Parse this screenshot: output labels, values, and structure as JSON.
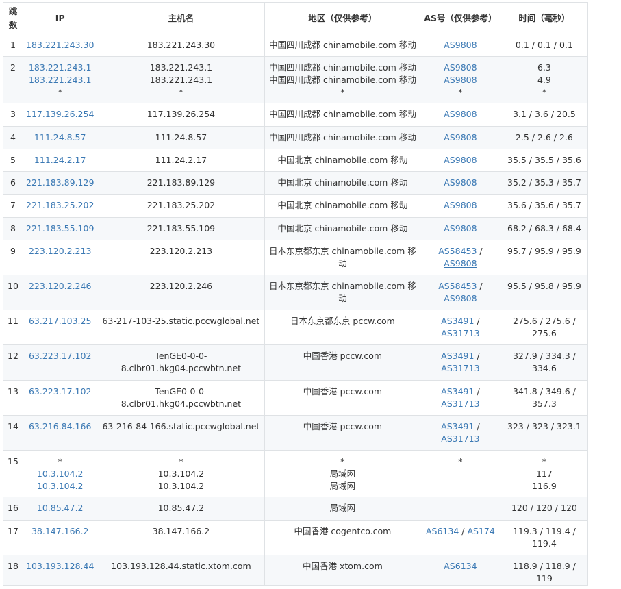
{
  "headers": [
    "跳数",
    "IP",
    "主机名",
    "地区（仅供参考）",
    "AS号（仅供参考）",
    "时间（毫秒）"
  ],
  "rows": [
    {
      "hop": "1",
      "ip": [
        "183.221.243.30"
      ],
      "host": [
        "183.221.243.30"
      ],
      "region": [
        "中国四川成都 chinamobile.com 移动"
      ],
      "as": [
        [
          "AS9808"
        ]
      ],
      "time": [
        "0.1 / 0.1 / 0.1"
      ]
    },
    {
      "hop": "2",
      "ip": [
        "183.221.243.1",
        "183.221.243.1",
        "*"
      ],
      "host": [
        "183.221.243.1",
        "183.221.243.1",
        "*"
      ],
      "region": [
        "中国四川成都 chinamobile.com 移动",
        "中国四川成都 chinamobile.com 移动",
        "*"
      ],
      "as": [
        [
          "AS9808"
        ],
        [
          "AS9808"
        ],
        [
          "*"
        ]
      ],
      "time": [
        "6.3",
        "4.9",
        "*"
      ]
    },
    {
      "hop": "3",
      "ip": [
        "117.139.26.254"
      ],
      "host": [
        "117.139.26.254"
      ],
      "region": [
        "中国四川成都 chinamobile.com 移动"
      ],
      "as": [
        [
          "AS9808"
        ]
      ],
      "time": [
        "3.1 / 3.6 / 20.5"
      ]
    },
    {
      "hop": "4",
      "ip": [
        "111.24.8.57"
      ],
      "host": [
        "111.24.8.57"
      ],
      "region": [
        "中国四川成都 chinamobile.com 移动"
      ],
      "as": [
        [
          "AS9808"
        ]
      ],
      "time": [
        "2.5 / 2.6 / 2.6"
      ]
    },
    {
      "hop": "5",
      "ip": [
        "111.24.2.17"
      ],
      "host": [
        "111.24.2.17"
      ],
      "region": [
        "中国北京 chinamobile.com 移动"
      ],
      "as": [
        [
          "AS9808"
        ]
      ],
      "time": [
        "35.5 / 35.5 / 35.6"
      ]
    },
    {
      "hop": "6",
      "ip": [
        "221.183.89.129"
      ],
      "host": [
        "221.183.89.129"
      ],
      "region": [
        "中国北京 chinamobile.com 移动"
      ],
      "as": [
        [
          "AS9808"
        ]
      ],
      "time": [
        "35.2 / 35.3 / 35.7"
      ]
    },
    {
      "hop": "7",
      "ip": [
        "221.183.25.202"
      ],
      "host": [
        "221.183.25.202"
      ],
      "region": [
        "中国北京 chinamobile.com 移动"
      ],
      "as": [
        [
          "AS9808"
        ]
      ],
      "time": [
        "35.6 / 35.6 / 35.7"
      ]
    },
    {
      "hop": "8",
      "ip": [
        "221.183.55.109"
      ],
      "host": [
        "221.183.55.109"
      ],
      "region": [
        "中国北京 chinamobile.com 移动"
      ],
      "as": [
        [
          "AS9808"
        ]
      ],
      "time": [
        "68.2 / 68.3 / 68.4"
      ]
    },
    {
      "hop": "9",
      "ip": [
        "223.120.2.213"
      ],
      "host": [
        "223.120.2.213"
      ],
      "region": [
        "日本东京都东京 chinamobile.com 移",
        "动"
      ],
      "as": [
        [
          "AS58453",
          " /"
        ],
        [
          "AS9808"
        ]
      ],
      "time": [
        "95.7 / 95.9 / 95.9"
      ],
      "underline": "AS9808"
    },
    {
      "hop": "10",
      "ip": [
        "223.120.2.246"
      ],
      "host": [
        "223.120.2.246"
      ],
      "region": [
        "日本东京都东京 chinamobile.com 移",
        "动"
      ],
      "as": [
        [
          "AS58453",
          " /"
        ],
        [
          "AS9808"
        ]
      ],
      "time": [
        "95.5 / 95.8 / 95.9"
      ]
    },
    {
      "hop": "11",
      "ip": [
        "63.217.103.25"
      ],
      "host": [
        "63-217-103-25.static.pccwglobal.net"
      ],
      "region": [
        "日本东京都东京 pccw.com"
      ],
      "as": [
        [
          "AS3491",
          " /"
        ],
        [
          "AS31713"
        ]
      ],
      "time": [
        "275.6 / 275.6 /",
        "275.6"
      ]
    },
    {
      "hop": "12",
      "ip": [
        "63.223.17.102"
      ],
      "host": [
        "TenGE0-0-0-",
        "8.clbr01.hkg04.pccwbtn.net"
      ],
      "region": [
        "中国香港 pccw.com"
      ],
      "as": [
        [
          "AS3491",
          " /"
        ],
        [
          "AS31713"
        ]
      ],
      "time": [
        "327.9 / 334.3 /",
        "334.6"
      ]
    },
    {
      "hop": "13",
      "ip": [
        "63.223.17.102"
      ],
      "host": [
        "TenGE0-0-0-",
        "8.clbr01.hkg04.pccwbtn.net"
      ],
      "region": [
        "中国香港 pccw.com"
      ],
      "as": [
        [
          "AS3491",
          " /"
        ],
        [
          "AS31713"
        ]
      ],
      "time": [
        "341.8 / 349.6 /",
        "357.3"
      ]
    },
    {
      "hop": "14",
      "ip": [
        "63.216.84.166"
      ],
      "host": [
        "63-216-84-166.static.pccwglobal.net"
      ],
      "region": [
        "中国香港 pccw.com"
      ],
      "as": [
        [
          "AS3491",
          " /"
        ],
        [
          "AS31713"
        ]
      ],
      "time": [
        "323 / 323 / 323.1"
      ]
    },
    {
      "hop": "15",
      "ip": [
        "*",
        "10.3.104.2",
        "10.3.104.2"
      ],
      "host": [
        "*",
        "10.3.104.2",
        "10.3.104.2"
      ],
      "region": [
        "*",
        "局域网",
        "局域网"
      ],
      "as": [
        [
          "*"
        ]
      ],
      "time": [
        "*",
        "117",
        "116.9"
      ]
    },
    {
      "hop": "16",
      "ip": [
        "10.85.47.2"
      ],
      "host": [
        "10.85.47.2"
      ],
      "region": [
        "局域网"
      ],
      "as": [],
      "time": [
        "120 / 120 / 120"
      ]
    },
    {
      "hop": "17",
      "ip": [
        "38.147.166.2"
      ],
      "host": [
        "38.147.166.2"
      ],
      "region": [
        "中国香港 cogentco.com"
      ],
      "as": [
        [
          "AS6134",
          " / ",
          "AS174"
        ]
      ],
      "time": [
        "119.3 / 119.4 /",
        "119.4"
      ]
    },
    {
      "hop": "18",
      "ip": [
        "103.193.128.44"
      ],
      "host": [
        "103.193.128.44.static.xtom.com"
      ],
      "region": [
        "中国香港 xtom.com"
      ],
      "as": [
        [
          "AS6134"
        ]
      ],
      "time": [
        "118.9 / 118.9 / 119"
      ]
    }
  ]
}
